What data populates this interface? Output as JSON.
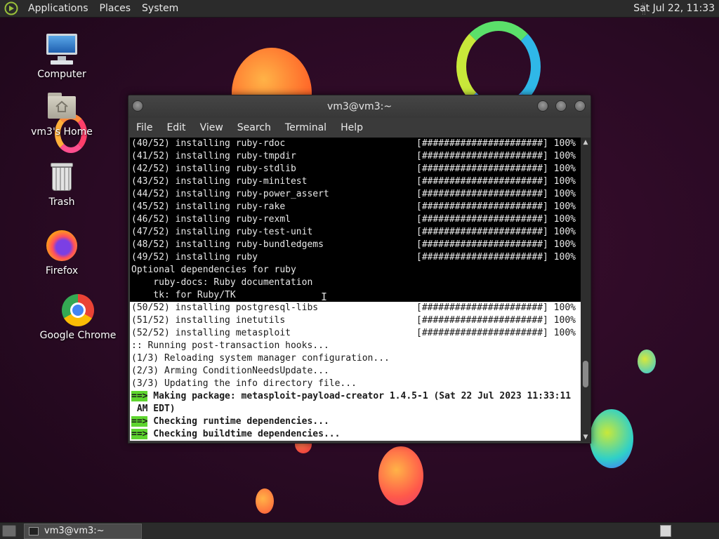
{
  "top_panel": {
    "menus": [
      "Applications",
      "Places",
      "System"
    ],
    "clock": "Sat Jul 22, 11:33"
  },
  "desktop_icons": [
    {
      "label": "Computer",
      "icon": "computer-icon"
    },
    {
      "label": "vm3's Home",
      "icon": "home-folder-icon"
    },
    {
      "label": "Trash",
      "icon": "trash-icon"
    },
    {
      "label": "Firefox",
      "icon": "firefox-icon"
    },
    {
      "label": "Google Chrome",
      "icon": "chrome-icon"
    }
  ],
  "terminal": {
    "title": "vm3@vm3:~",
    "menu": [
      "File",
      "Edit",
      "View",
      "Search",
      "Terminal",
      "Help"
    ],
    "progress_bar": "[######################]",
    "install_lines": [
      {
        "text": "(40/52) installing ruby-rdoc",
        "pct": "100%"
      },
      {
        "text": "(41/52) installing ruby-tmpdir",
        "pct": "100%"
      },
      {
        "text": "(42/52) installing ruby-stdlib",
        "pct": "100%"
      },
      {
        "text": "(43/52) installing ruby-minitest",
        "pct": "100%"
      },
      {
        "text": "(44/52) installing ruby-power_assert",
        "pct": "100%"
      },
      {
        "text": "(45/52) installing ruby-rake",
        "pct": "100%"
      },
      {
        "text": "(46/52) installing ruby-rexml",
        "pct": "100%"
      },
      {
        "text": "(47/52) installing ruby-test-unit",
        "pct": "100%"
      },
      {
        "text": "(48/52) installing ruby-bundledgems",
        "pct": "100%"
      },
      {
        "text": "(49/52) installing ruby",
        "pct": "100%"
      }
    ],
    "optional_header": "Optional dependencies for ruby",
    "optional_lines": [
      "    ruby-docs: Ruby documentation",
      "    tk: for Ruby/TK"
    ],
    "install_lines_2": [
      {
        "text": "(50/52) installing postgresql-libs",
        "pct": "100%"
      },
      {
        "text": "(51/52) installing inetutils",
        "pct": "100%"
      },
      {
        "text": "(52/52) installing metasploit",
        "pct": "100%"
      }
    ],
    "hook_lines": [
      ":: Running post-transaction hooks...",
      "(1/3) Reloading system manager configuration...",
      "(2/3) Arming ConditionNeedsUpdate...",
      "(3/3) Updating the info directory file..."
    ],
    "arrow": "==>",
    "making_package": " Making package: metasploit-payload-creator 1.4.5-1 (Sat 22 Jul 2023 11:33:11",
    "making_package_cont": " AM EDT)",
    "checking_runtime": " Checking runtime dependencies...",
    "checking_buildtime": " Checking buildtime dependencies..."
  },
  "taskbar": {
    "window_label": "vm3@vm3:~"
  },
  "colors": {
    "arrow_green": "#5ed52f",
    "desktop_bg": "#2a0a24"
  }
}
